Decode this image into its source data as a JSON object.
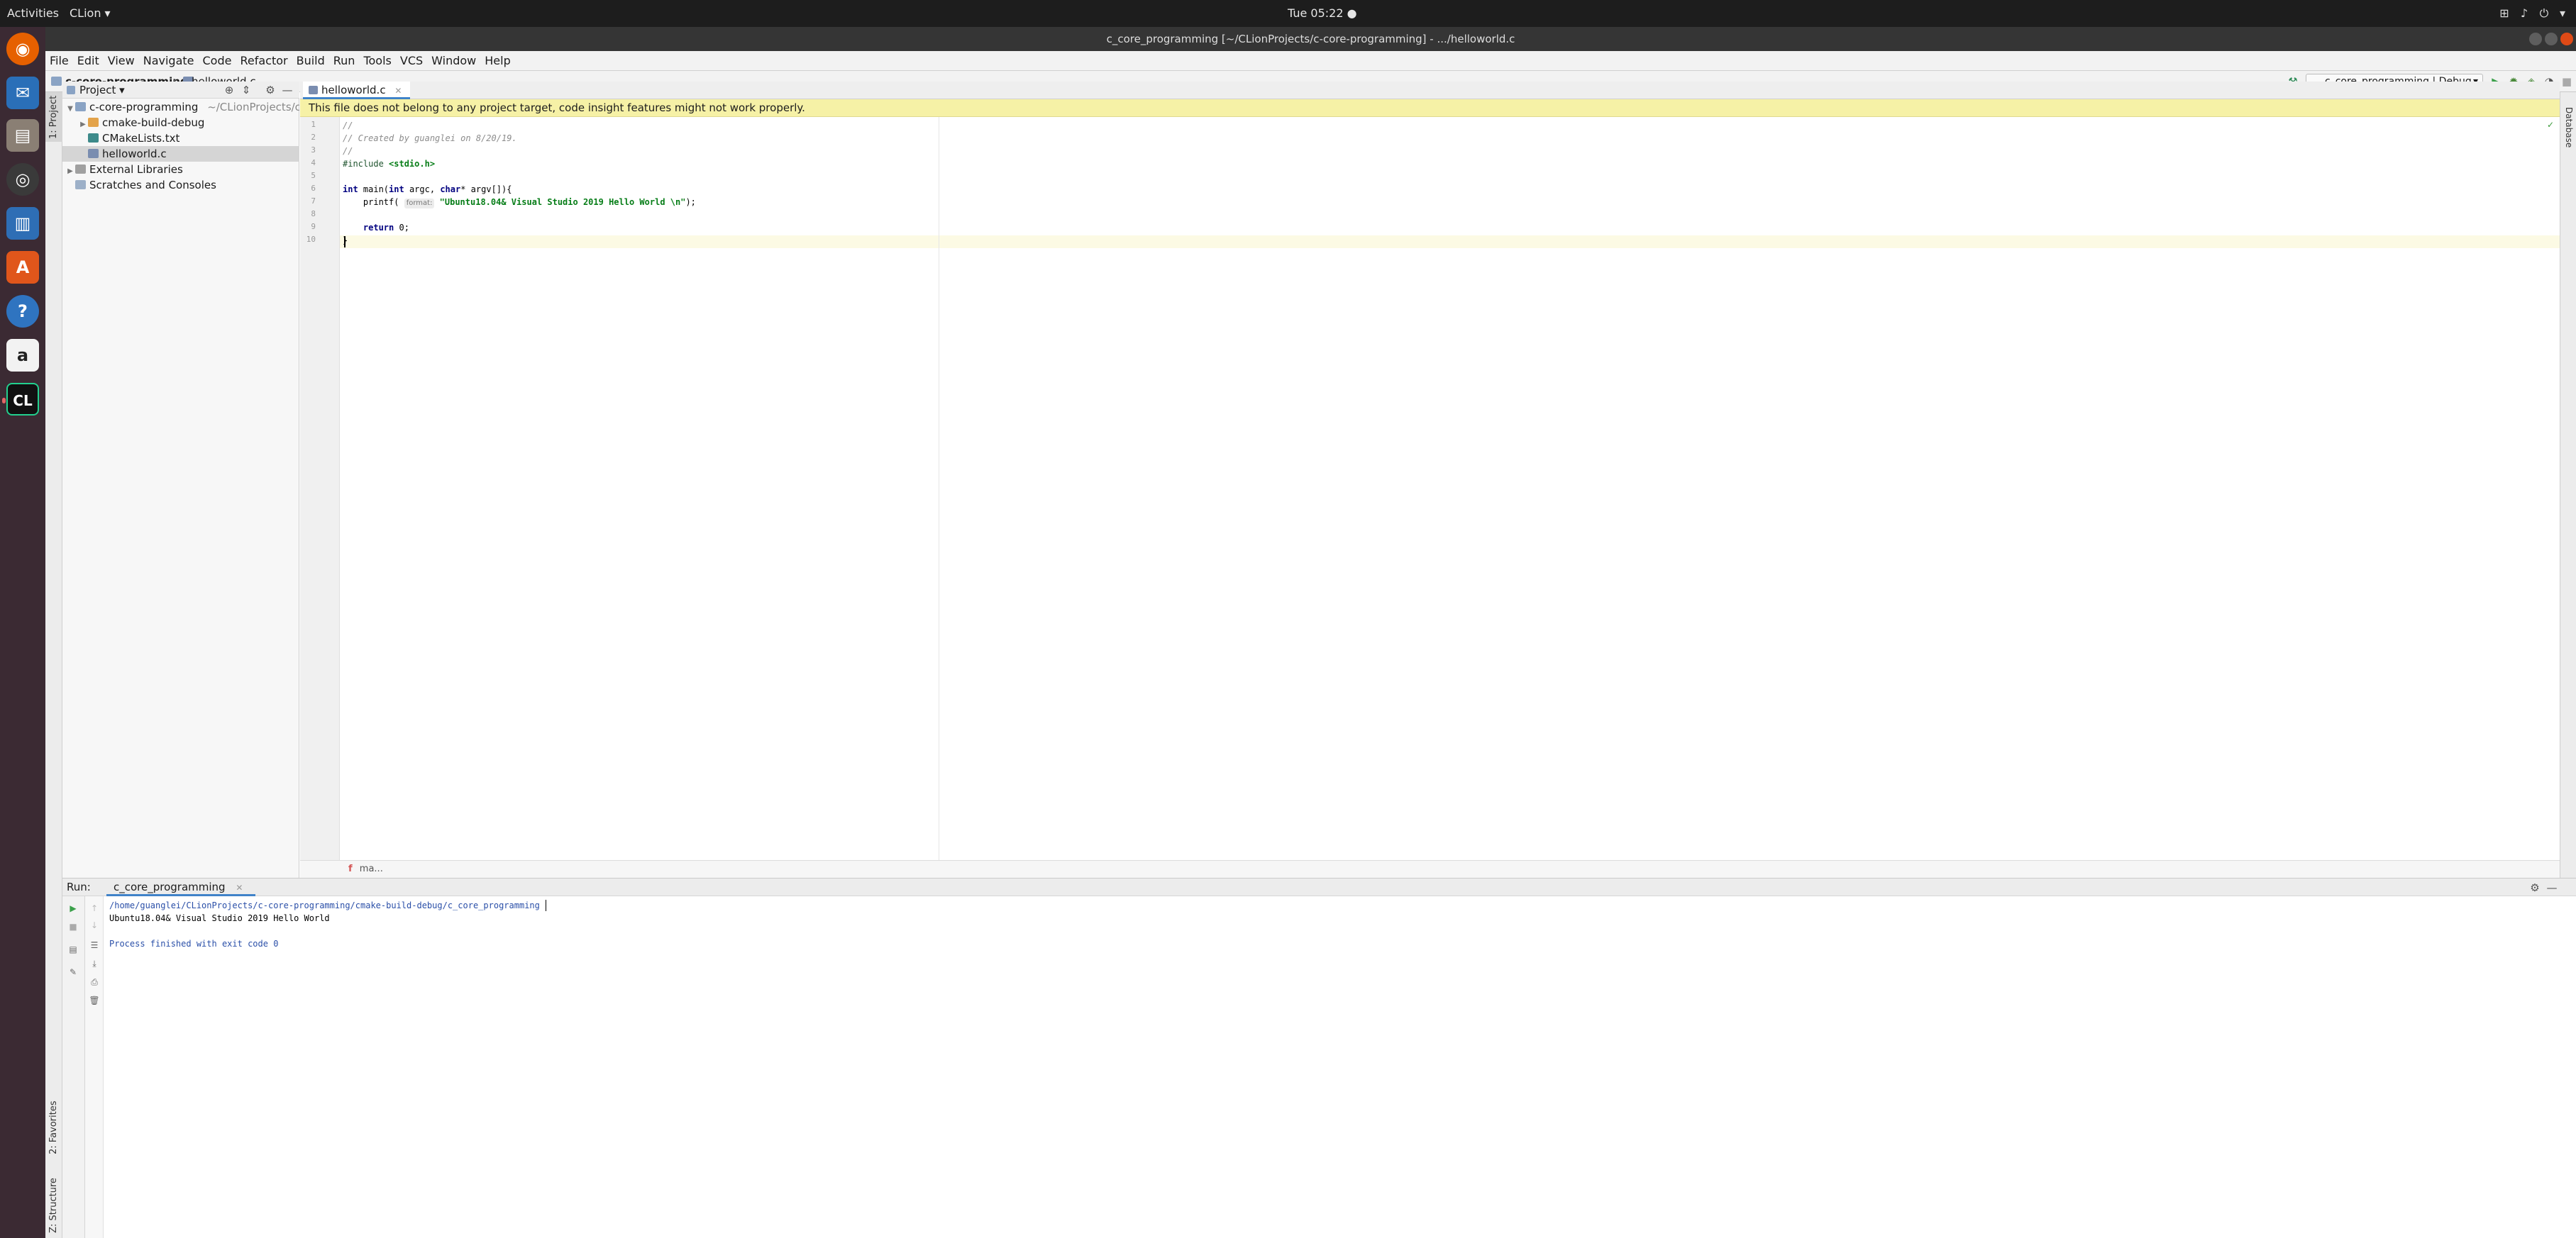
{
  "topbar": {
    "activities": "Activities",
    "app_menu": "CLion ▾",
    "clock": "Tue 05:22 ●"
  },
  "window": {
    "title": "c_core_programming [~/CLionProjects/c-core-programming] - .../helloworld.c"
  },
  "menu": {
    "items": [
      "File",
      "Edit",
      "View",
      "Navigate",
      "Code",
      "Refactor",
      "Build",
      "Run",
      "Tools",
      "VCS",
      "Window",
      "Help"
    ]
  },
  "nav": {
    "project_crumb": "c-core-programming",
    "file_crumb": "helloworld.c",
    "run_config": "c_core_programming | Debug"
  },
  "stripes": {
    "project": "1: Project",
    "favorites": "2: Favorites",
    "structure": "Z: Structure",
    "database": "Database"
  },
  "project_panel": {
    "header": "Project ▾",
    "tree": [
      {
        "label": "c-core-programming",
        "suffix": "~/CLionProjects/c-cor"
      },
      {
        "label": "cmake-build-debug"
      },
      {
        "label": "CMakeLists.txt"
      },
      {
        "label": "helloworld.c"
      },
      {
        "label": "External Libraries"
      },
      {
        "label": "Scratches and Consoles"
      }
    ]
  },
  "editor": {
    "tab": "helloworld.c",
    "banner": "This file does not belong to any project target, code insight features might not work properly.",
    "line_numbers": [
      "1",
      "2",
      "3",
      "4",
      "5",
      "6",
      "7",
      "8",
      "9",
      "10"
    ],
    "code": {
      "l1": "//",
      "l2": "// Created by guanglei on 8/20/19.",
      "l3": "//",
      "l4_kw": "#include ",
      "l4_inc": "<stdio.h>",
      "l6_a": "int",
      "l6_b": " main(",
      "l6_c": "int",
      "l6_d": " argc, ",
      "l6_e": "char",
      "l6_f": "* argv[]){",
      "l7_a": "    printf( ",
      "l7_hint": "format:",
      "l7_str": " \"Ubuntu18.04& Visual Studio 2019 Hello World \\n\"",
      "l7_end": ");",
      "l9_kw": "    return",
      "l9_end": " 0;",
      "l10": "}"
    },
    "breadcrumb": "ma..."
  },
  "run_panel": {
    "label": "Run:",
    "tab": "c_core_programming",
    "console": [
      "/home/guanglei/CLionProjects/c-core-programming/cmake-build-debug/c_core_programming",
      "Ubuntu18.04& Visual Studio 2019 Hello World",
      "",
      "Process finished with exit code 0"
    ]
  },
  "colors": {
    "accent": "#4083c9",
    "banner": "#f6f1a6",
    "dock": "#3b2a33"
  }
}
